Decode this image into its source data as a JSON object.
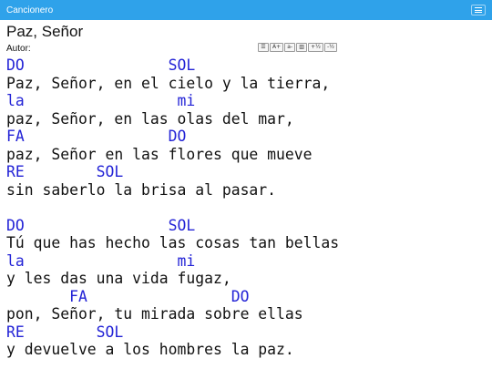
{
  "nav": {
    "title": "Cancionero",
    "menu_icon": "hamburger-menu-icon"
  },
  "song": {
    "title": "Paz, Señor",
    "author_label": "Autor:"
  },
  "toolbar": {
    "buttons": [
      {
        "label": "☰",
        "icon": "list-icon"
      },
      {
        "label": "A+",
        "icon": "font-increase-icon"
      },
      {
        "label": "a-",
        "icon": "font-decrease-icon"
      },
      {
        "label": "▥",
        "icon": "columns-icon"
      },
      {
        "label": "+½",
        "icon": "transpose-up-icon"
      },
      {
        "label": "-½",
        "icon": "transpose-down-icon"
      }
    ]
  },
  "colors": {
    "navbar": "#2fa2ea",
    "chord": "#2323d6"
  },
  "lyrics": {
    "verse1": [
      {
        "chords": "DO                SOL",
        "text": "Paz, Señor, en el cielo y la tierra,"
      },
      {
        "chords": "la                 mi",
        "text": "paz, Señor, en las olas del mar,"
      },
      {
        "chords": "FA                DO",
        "text": "paz, Señor en las flores que mueve"
      },
      {
        "chords": "RE        SOL",
        "text": "sin saberlo la brisa al pasar."
      }
    ],
    "verse2": [
      {
        "chords": "DO                SOL",
        "text": "Tú que has hecho las cosas tan bellas"
      },
      {
        "chords": "la                 mi",
        "text": "y les das una vida fugaz,"
      },
      {
        "chords": "       FA                DO",
        "text": "pon, Señor, tu mirada sobre ellas"
      },
      {
        "chords": "RE        SOL",
        "text": "y devuelve a los hombres la paz."
      }
    ]
  }
}
